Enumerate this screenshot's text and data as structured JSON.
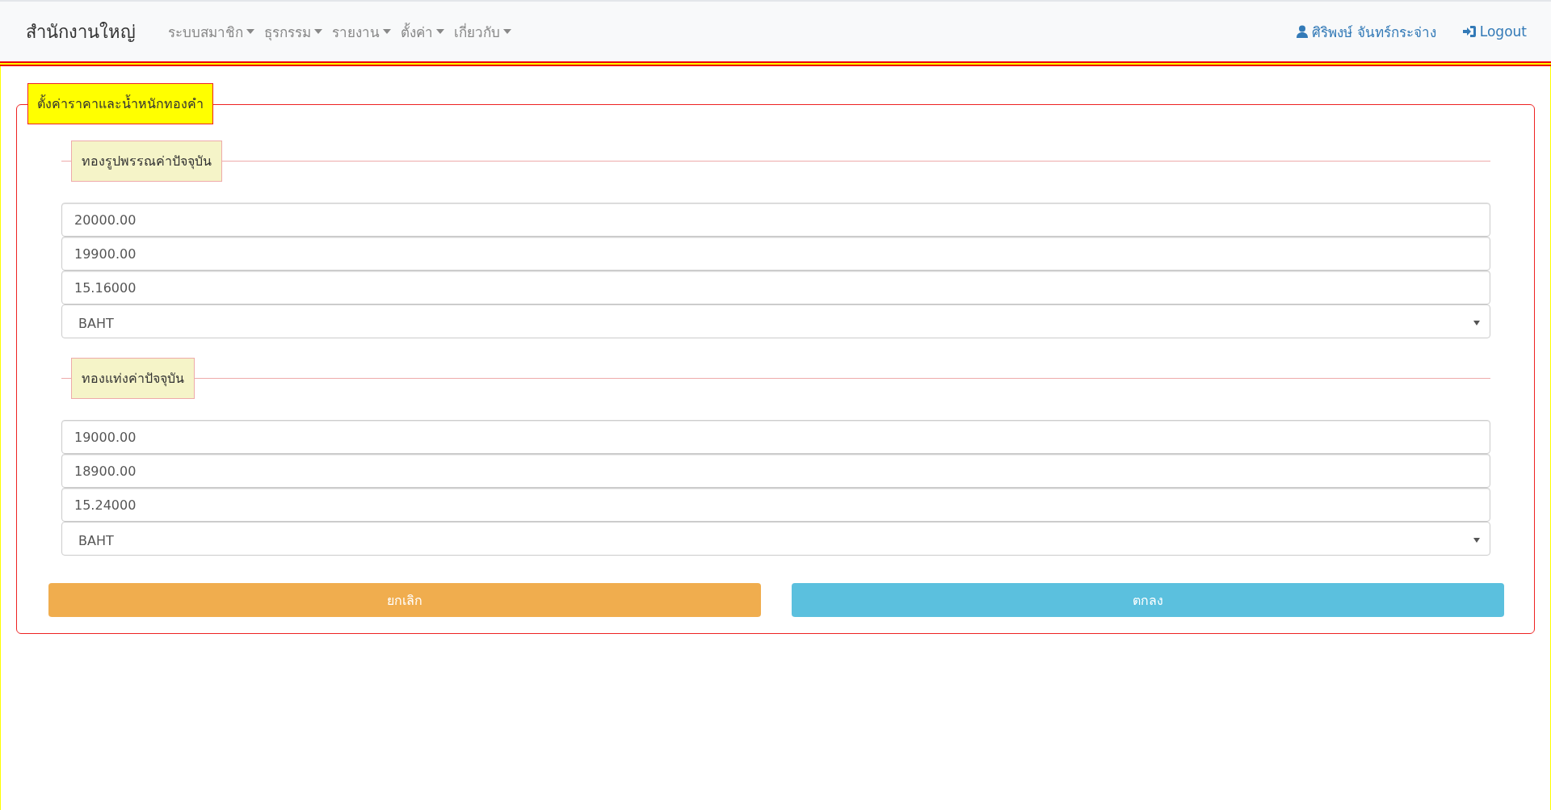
{
  "navbar": {
    "brand": "สำนักงานใหญ่",
    "menus": [
      {
        "label": "ระบบสมาชิก"
      },
      {
        "label": "ธุรกรรม"
      },
      {
        "label": "รายงาน"
      },
      {
        "label": "ตั้งค่า"
      },
      {
        "label": "เกี่ยวกับ"
      }
    ],
    "user": "ศิริพงษ์ จันทร์กระจ่าง",
    "logout": "Logout"
  },
  "form": {
    "title": "ตั้งค่าราคาและน้ำหนักทองคำ",
    "sections": [
      {
        "title": "ทองรูปพรรณค่าปัจจุบัน",
        "fields": [
          "20000.00",
          "19900.00",
          "15.16000"
        ],
        "unit": "BAHT"
      },
      {
        "title": "ทองแท่งค่าปัจจุบัน",
        "fields": [
          "19000.00",
          "18900.00",
          "15.24000"
        ],
        "unit": "BAHT"
      }
    ],
    "buttons": [
      {
        "label": "ยกเลิก",
        "kind": "cancel"
      },
      {
        "label": "ตกลง",
        "kind": "ok"
      }
    ]
  }
}
